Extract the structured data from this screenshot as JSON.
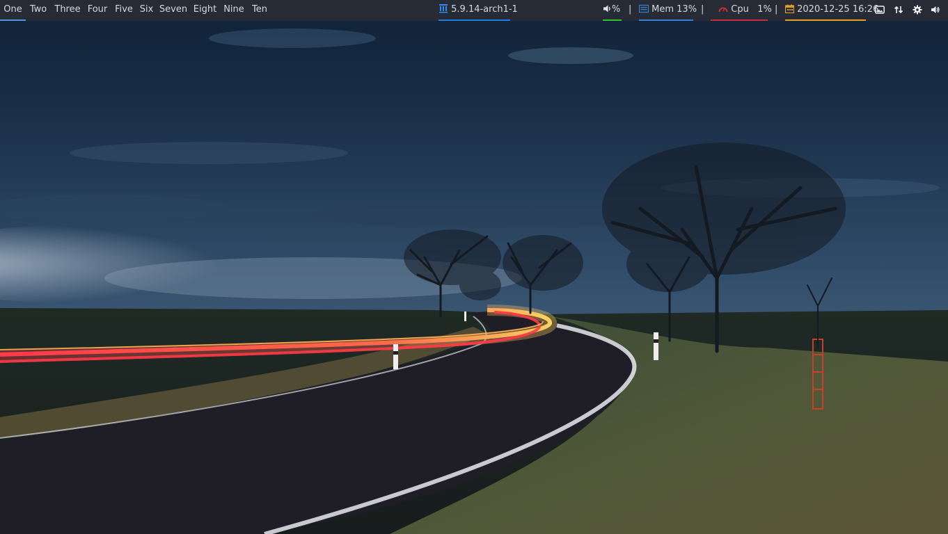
{
  "workspaces": [
    {
      "label": "One",
      "active": true
    },
    {
      "label": "Two",
      "active": false
    },
    {
      "label": "Three",
      "active": false
    },
    {
      "label": "Four",
      "active": false
    },
    {
      "label": "Five",
      "active": false
    },
    {
      "label": "Six",
      "active": false
    },
    {
      "label": "Seven",
      "active": false
    },
    {
      "label": "Eight",
      "active": false
    },
    {
      "label": "Nine",
      "active": false
    },
    {
      "label": "Ten",
      "active": false
    }
  ],
  "kernel": {
    "icon": "archlinux-icon",
    "text": "5.9.14-arch1-1",
    "color": "#1f7fe0"
  },
  "volume": {
    "icon": "speaker-icon",
    "text": "%",
    "color": "#30c030"
  },
  "memory": {
    "icon": "memory-icon",
    "text": "Mem 13%",
    "color": "#3a7fd0"
  },
  "cpu": {
    "icon": "gauge-icon",
    "text": "Cpu   1%",
    "color": "#d02a3a"
  },
  "clock": {
    "icon": "calendar-icon",
    "text": "2020-12-25 16:26",
    "color": "#e0a020"
  },
  "separator": "|",
  "tray": [
    "image-viewer-icon",
    "network-transfer-icon",
    "gear-icon",
    "speaker-icon"
  ],
  "colors": {
    "panel_bg": "#272b35",
    "panel_text": "#d5d9e0",
    "active_workspace": "#5294e2"
  }
}
